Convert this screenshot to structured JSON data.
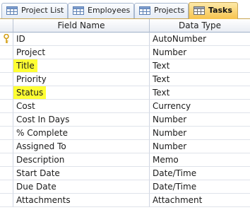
{
  "tabs": [
    {
      "label": "Project List",
      "active": false
    },
    {
      "label": "Employees",
      "active": false
    },
    {
      "label": "Projects",
      "active": false
    },
    {
      "label": "Tasks",
      "active": true
    }
  ],
  "grid": {
    "headers": {
      "field_name": "Field Name",
      "data_type": "Data Type"
    },
    "rows": [
      {
        "field": "ID",
        "type": "AutoNumber",
        "primary_key": true,
        "highlighted": false
      },
      {
        "field": "Project",
        "type": "Number",
        "highlighted": false
      },
      {
        "field": "Title",
        "type": "Text",
        "highlighted": true
      },
      {
        "field": "Priority",
        "type": "Text",
        "highlighted": false
      },
      {
        "field": "Status",
        "type": "Text",
        "highlighted": true
      },
      {
        "field": "Cost",
        "type": "Currency",
        "highlighted": false
      },
      {
        "field": "Cost In Days",
        "type": "Number",
        "highlighted": false
      },
      {
        "field": "% Complete",
        "type": "Number",
        "highlighted": false
      },
      {
        "field": "Assigned To",
        "type": "Number",
        "highlighted": false
      },
      {
        "field": "Description",
        "type": "Memo",
        "highlighted": false
      },
      {
        "field": "Start Date",
        "type": "Date/Time",
        "highlighted": false
      },
      {
        "field": "Due Date",
        "type": "Date/Time",
        "highlighted": false
      },
      {
        "field": "Attachments",
        "type": "Attachment",
        "highlighted": false
      }
    ]
  },
  "colors": {
    "highlight": "#ffff33",
    "active_tab": "#f7c34d",
    "key_icon": "#d4a017"
  },
  "icons": {
    "tab": "table-icon",
    "primary_key": "key-icon"
  }
}
